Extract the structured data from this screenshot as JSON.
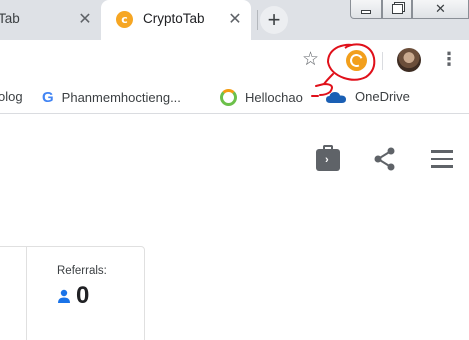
{
  "browser": {
    "tabs": [
      {
        "title": "Tab",
        "active": false
      },
      {
        "title": "CryptoTab",
        "active": true,
        "favicon": "cryptotab-c-icon"
      }
    ],
    "new_tab": "+",
    "tab_close": "✕",
    "window_controls": {
      "close": "✕"
    }
  },
  "toolbar": {
    "bookmark_star": "☆",
    "extension": "cryptotab-extension-icon",
    "menu": "⋮"
  },
  "bookmarks": [
    {
      "label": "olog",
      "icon": ""
    },
    {
      "label": "Phanmemhoctieng...",
      "icon": "google-g-icon"
    },
    {
      "label": "Hellochao",
      "icon": "hellochao-icon"
    },
    {
      "label": "OneDrive",
      "icon": "onedrive-cloud-icon"
    }
  ],
  "google_letter": "G",
  "page": {
    "icons": [
      "wallet-icon",
      "share-icon",
      "menu-icon"
    ],
    "referrals": {
      "label": "Referrals:",
      "value": "0"
    }
  },
  "colors": {
    "accent": "#f29f1c",
    "annotation": "#e0101a",
    "tabstrip": "#dee1e6",
    "icon_blue": "#1a73e8"
  }
}
